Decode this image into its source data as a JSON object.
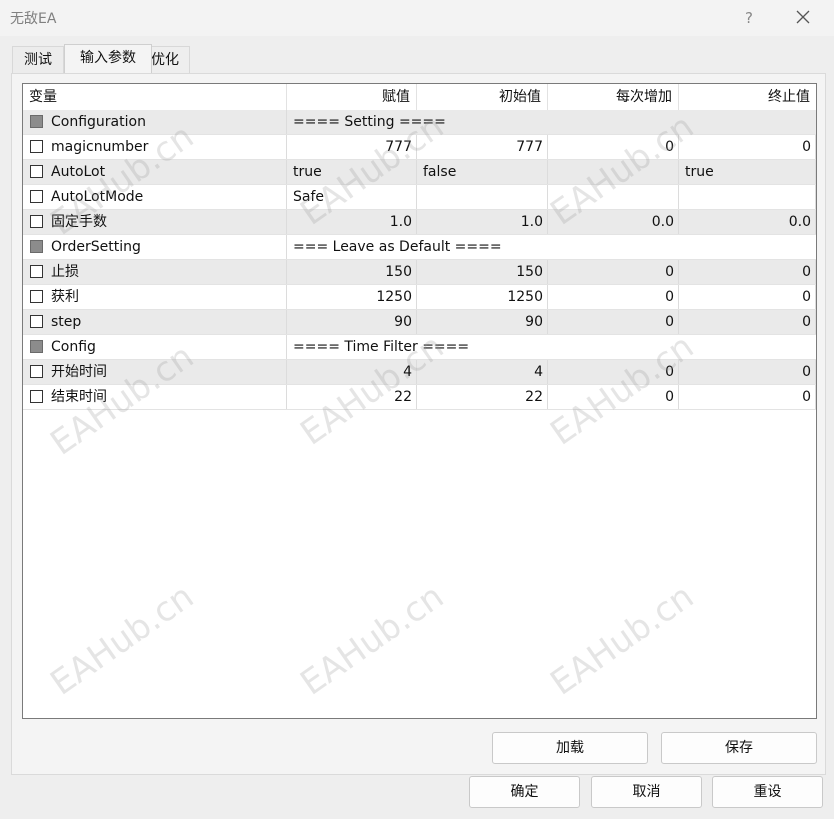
{
  "window": {
    "title": "无敌EA",
    "help_label": "?"
  },
  "tabs": [
    {
      "label": "测试",
      "active": false
    },
    {
      "label": "输入参数",
      "active": true
    },
    {
      "label": "优化",
      "active": false
    }
  ],
  "table": {
    "columns": [
      "变量",
      "赋值",
      "初始值",
      "每次增加",
      "终止值"
    ],
    "rows": [
      {
        "name": "Configuration",
        "group": true,
        "value": "==== Setting ====",
        "start": "",
        "step": "",
        "stop": ""
      },
      {
        "name": "magicnumber",
        "group": false,
        "value": "777",
        "start": "777",
        "step": "0",
        "stop": "0"
      },
      {
        "name": "AutoLot",
        "group": false,
        "value": "true",
        "start": "false",
        "step": "",
        "stop": "true"
      },
      {
        "name": "AutoLotMode",
        "group": false,
        "value": "Safe",
        "start": "",
        "step": "",
        "stop": ""
      },
      {
        "name": "固定手数",
        "group": false,
        "value": "1.0",
        "start": "1.0",
        "step": "0.0",
        "stop": "0.0"
      },
      {
        "name": "OrderSetting",
        "group": true,
        "value": "=== Leave as Default ====",
        "start": "",
        "step": "",
        "stop": ""
      },
      {
        "name": "止损",
        "group": false,
        "value": "150",
        "start": "150",
        "step": "0",
        "stop": "0"
      },
      {
        "name": "获利",
        "group": false,
        "value": "1250",
        "start": "1250",
        "step": "0",
        "stop": "0"
      },
      {
        "name": "step",
        "group": false,
        "value": "90",
        "start": "90",
        "step": "0",
        "stop": "0"
      },
      {
        "name": "Config",
        "group": true,
        "value": "==== Time Filter ====",
        "start": "",
        "step": "",
        "stop": ""
      },
      {
        "name": "开始时间",
        "group": false,
        "value": "4",
        "start": "4",
        "step": "0",
        "stop": "0"
      },
      {
        "name": "结束时间",
        "group": false,
        "value": "22",
        "start": "22",
        "step": "0",
        "stop": "0"
      }
    ]
  },
  "buttons": {
    "load": "加载",
    "save": "保存",
    "ok": "确定",
    "cancel": "取消",
    "reset": "重设"
  },
  "watermark": "EAHub.cn",
  "icons": {
    "close": "close-icon"
  }
}
